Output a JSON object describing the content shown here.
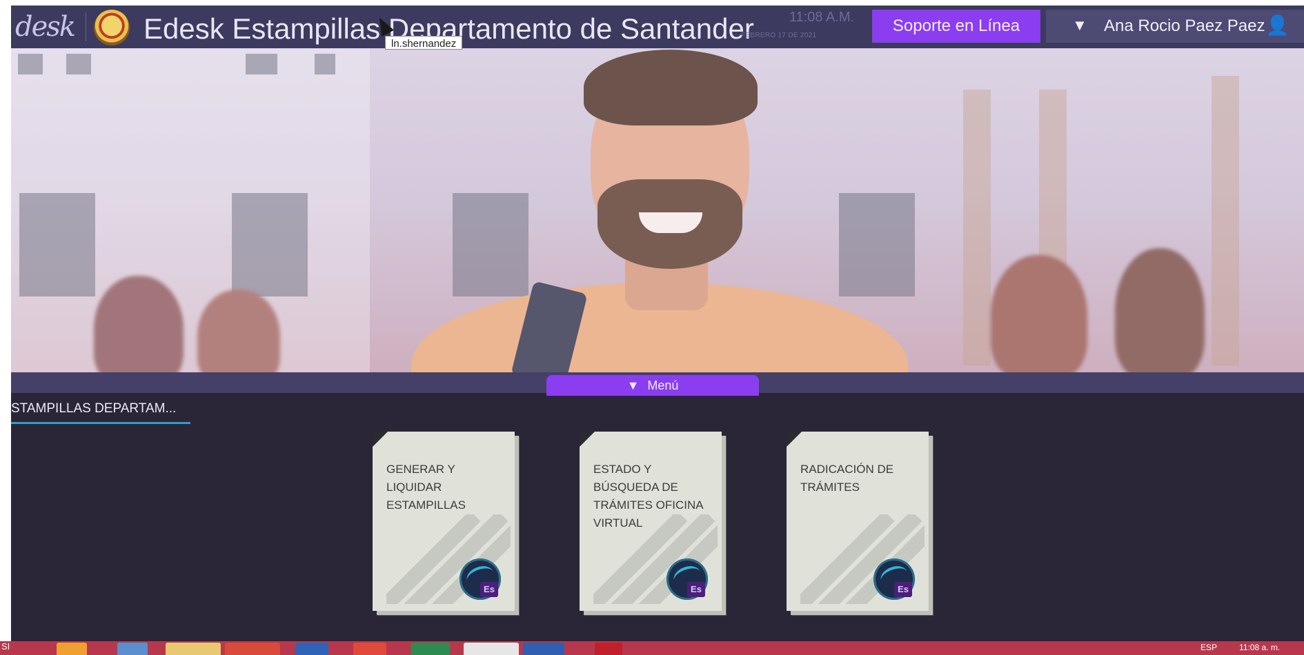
{
  "app": {
    "logo_text": "desk",
    "title": "Edesk Estampillas Departamento de Santander",
    "clock_time": "11:08 A.M.",
    "clock_date": "FEBRERO 17 DE 2021",
    "support_button": "Soporte en Línea",
    "user_name": "Ana Rocio Paez Paez",
    "tooltip": "ln.shernandez"
  },
  "menu": {
    "tab_label": "Menú",
    "section_title": "STAMPILLAS DEPARTAM..."
  },
  "cards": [
    {
      "label": "GENERAR Y LIQUIDAR ESTAMPILLAS",
      "badge": "Es"
    },
    {
      "label": "ESTADO Y BÚSQUEDA DE TRÁMITES OFICINA VIRTUAL",
      "badge": "Es"
    },
    {
      "label": "RADICACIÓN DE TRÁMITES",
      "badge": "Es"
    }
  ],
  "taskbar": {
    "start_text": "SI",
    "language": "ESP",
    "clock": "11:08 a. m."
  },
  "colors": {
    "topbar": "#3c3a5e",
    "accent_purple": "#8a3ef0",
    "background": "#2a2537",
    "card": "#e0e2d9",
    "section_underline": "#2e9fd0",
    "taskbar": "#b7384c"
  },
  "icons": {
    "seal": "department-seal-icon",
    "user_caret": "caret-down-icon",
    "user": "user-icon",
    "menu_caret": "caret-down-icon",
    "card_app": "estampillas-app-icon"
  }
}
